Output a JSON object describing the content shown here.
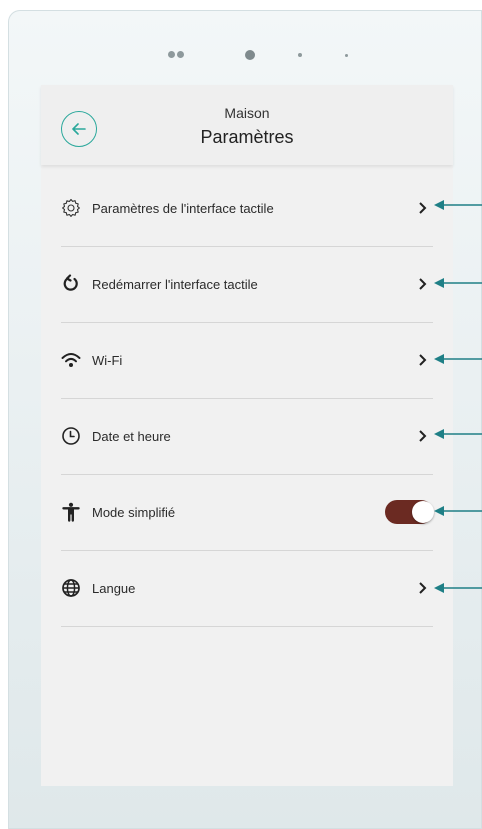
{
  "header": {
    "subtitle": "Maison",
    "title": "Paramètres"
  },
  "settings": {
    "items": [
      {
        "label": "Paramètres de l'interface tactile",
        "icon": "gear-icon"
      },
      {
        "label": "Redémarrer l'interface tactile",
        "icon": "restart-icon"
      },
      {
        "label": "Wi-Fi",
        "icon": "wifi-icon"
      },
      {
        "label": "Date et heure",
        "icon": "clock-icon"
      },
      {
        "label": "Mode simplifié",
        "icon": "accessibility-icon",
        "toggle_on": true
      },
      {
        "label": "Langue",
        "icon": "globe-icon"
      }
    ]
  },
  "colors": {
    "accent": "#2aa89b",
    "toggle_on": "#6b2a22",
    "annotation_arrow": "#1f7f86"
  }
}
